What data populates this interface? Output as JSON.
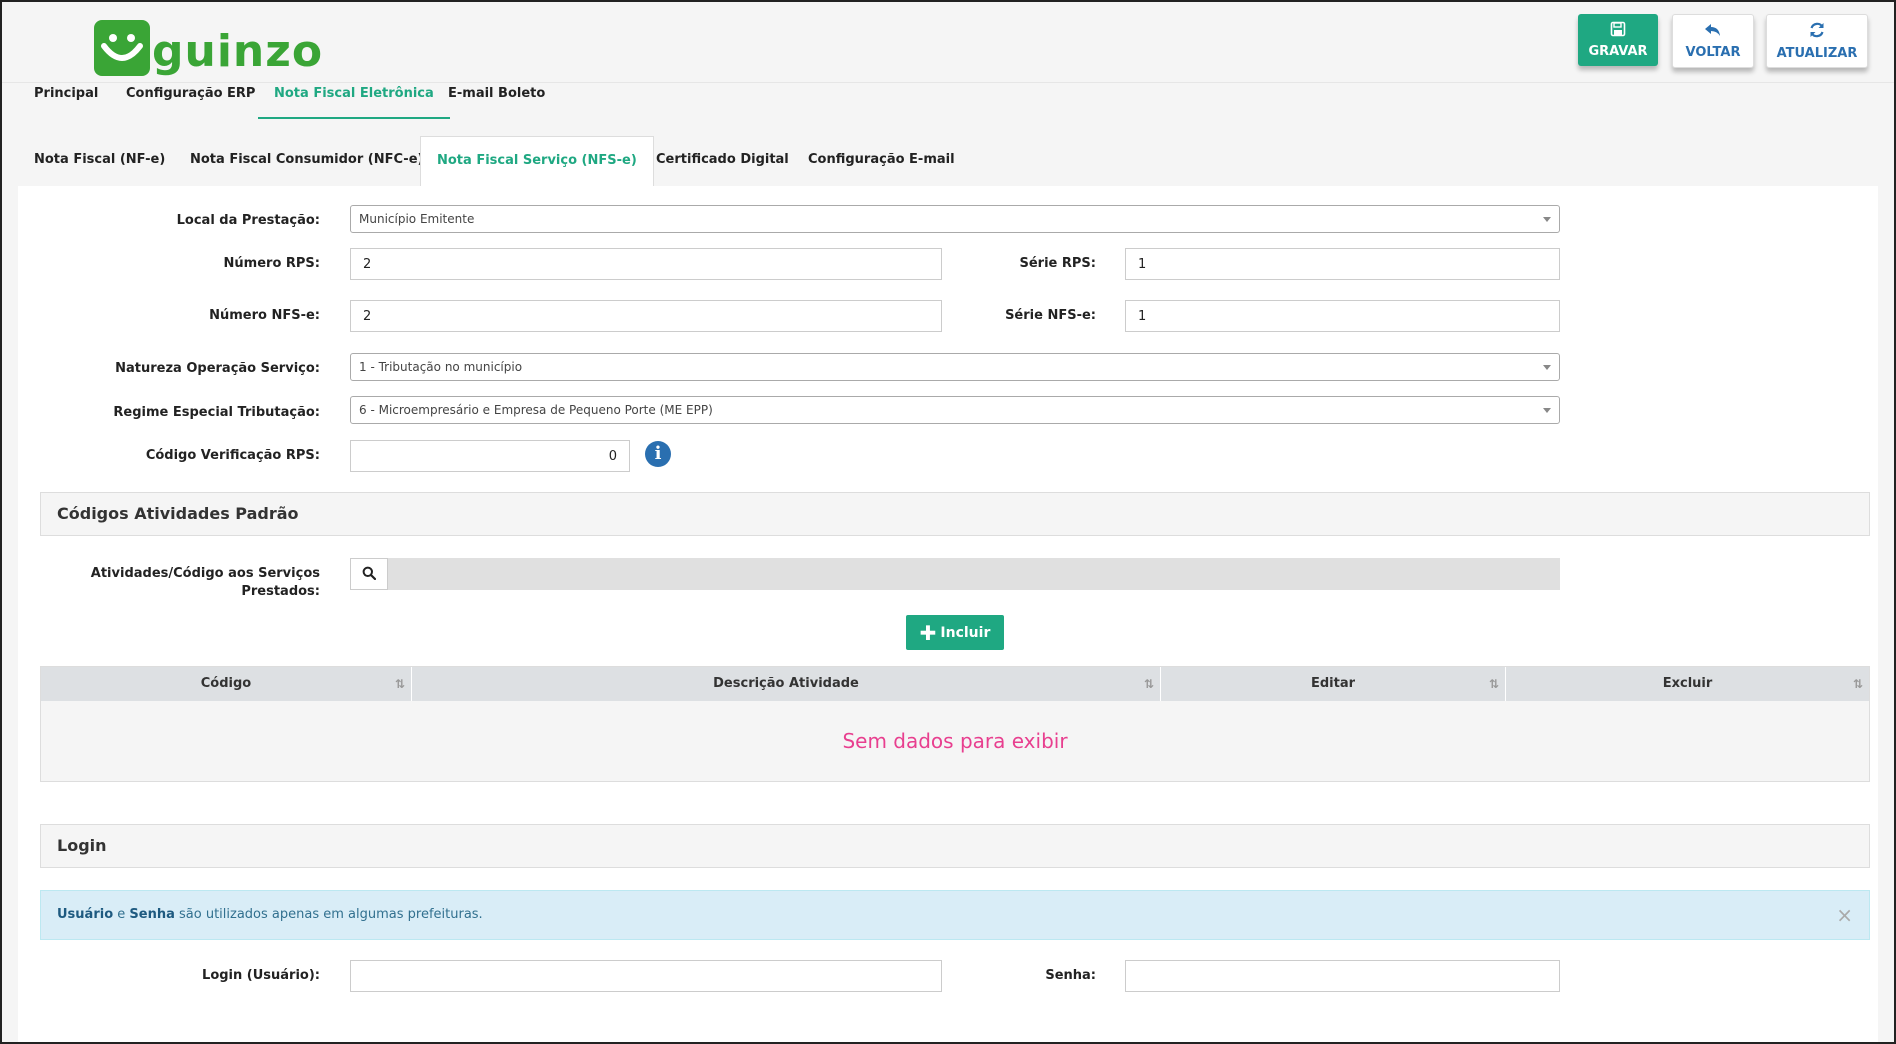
{
  "header": {
    "logo_text": "guinzo",
    "buttons": {
      "gravar": "GRAVAR",
      "voltar": "VOLTAR",
      "atualizar": "ATUALIZAR"
    }
  },
  "main_tabs": [
    "Principal",
    "Configuração ERP",
    "Nota Fiscal Eletrônica",
    "E-mail Boleto"
  ],
  "sub_tabs": [
    "Nota Fiscal (NF-e)",
    "Nota Fiscal Consumidor (NFC-e)",
    "Nota Fiscal Serviço (NFS-e)",
    "Certificado Digital",
    "Configuração E-mail"
  ],
  "form": {
    "local_prestacao": {
      "label": "Local da Prestação:",
      "value": "Município Emitente"
    },
    "numero_rps": {
      "label": "Número RPS:",
      "value": "2"
    },
    "serie_rps": {
      "label": "Série RPS:",
      "value": "1"
    },
    "numero_nfse": {
      "label": "Número NFS-e:",
      "value": "2"
    },
    "serie_nfse": {
      "label": "Série NFS-e:",
      "value": "1"
    },
    "natureza": {
      "label": "Natureza Operação Serviço:",
      "value": "1 - Tributação no município"
    },
    "regime": {
      "label": "Regime Especial Tributação:",
      "value": "6 - Microempresário e Empresa de Pequeno Porte (ME EPP)"
    },
    "codigo_verificacao": {
      "label": "Código Verificação RPS:",
      "value": "0"
    }
  },
  "atividades": {
    "title": "Códigos Atividades Padrão",
    "label_line1": "Atividades/Código aos Serviços",
    "label_line2": "Prestados:",
    "incluir": "Incluir",
    "columns": [
      "Código",
      "Descrição Atividade",
      "Editar",
      "Excluir"
    ],
    "empty": "Sem dados para exibir"
  },
  "login": {
    "title": "Login",
    "alert_user": "Usuário",
    "alert_and": "e",
    "alert_pass": "Senha",
    "alert_rest": "são utilizados apenas em algumas prefeituras.",
    "login_label": "Login (Usuário):",
    "senha_label": "Senha:",
    "login_value": "",
    "senha_value": ""
  },
  "colors": {
    "accent": "#1fa882",
    "brand": "#3aa536",
    "link": "#2a6fb0",
    "empty": "#e83f8f"
  }
}
